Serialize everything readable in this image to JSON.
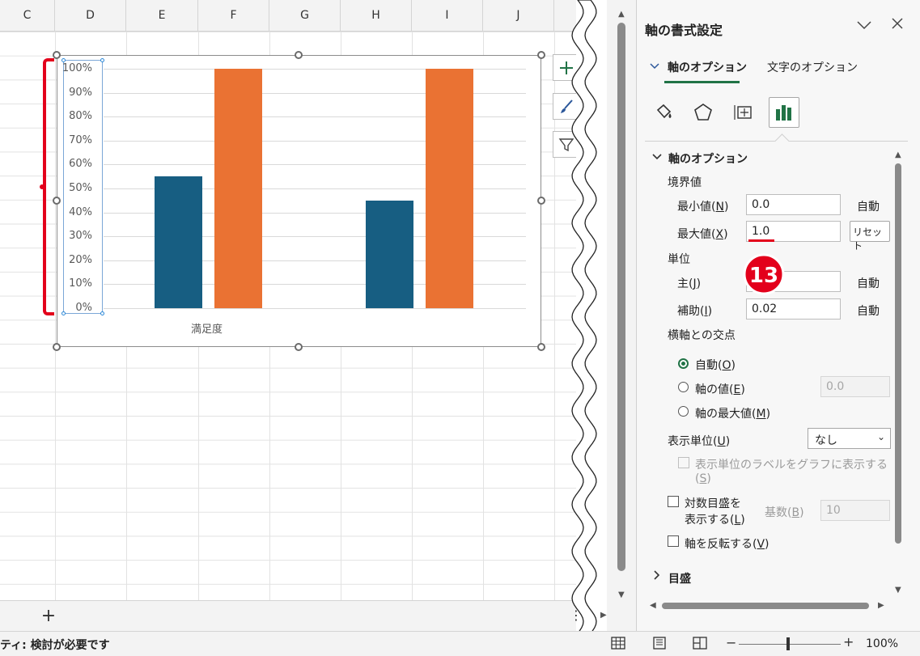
{
  "columns": [
    "C",
    "D",
    "E",
    "F",
    "G",
    "H",
    "I",
    "J"
  ],
  "chart_data": {
    "type": "bar",
    "categories": [
      "満足度"
    ],
    "series": [
      {
        "values": [
          0.55,
          0.45
        ],
        "color": "#175e82"
      },
      {
        "values": [
          1.0,
          1.0
        ],
        "color": "#ea7233"
      }
    ],
    "y_ticks": [
      "100%",
      "90%",
      "80%",
      "70%",
      "60%",
      "50%",
      "40%",
      "30%",
      "20%",
      "10%",
      "0%"
    ],
    "ylim": [
      0,
      1.0
    ],
    "grid": true
  },
  "colors": {
    "bar_blue": "#175e82",
    "bar_orange": "#ea7233",
    "accent_green": "#217346",
    "annotation_red": "#e3001b"
  },
  "sheet": {
    "add_sheet_label": "+",
    "more_label": "⋮",
    "status_text": "ティ: 検討が必要です",
    "zoom_minus": "−",
    "zoom_plus": "+",
    "zoom_level": "100%"
  },
  "pane": {
    "title": "軸の書式設定",
    "tabs": {
      "axis_options": "軸のオプション",
      "text_options": "文字のオプション"
    },
    "icons": [
      "fill-line-icon",
      "effects-icon",
      "size-properties-icon",
      "axis-options-icon"
    ],
    "section_axis_options": "軸のオプション",
    "bounds_label": "境界値",
    "min": {
      "label": "最小値(",
      "key": "N",
      "value": "0.0",
      "status": "自動"
    },
    "max": {
      "label": "最大値(",
      "key": "X",
      "value": "1.0",
      "reset": "リセット"
    },
    "units_label": "単位",
    "major": {
      "label": "主(",
      "key": "J",
      "value": "",
      "status": "自動"
    },
    "minor": {
      "label": "補助(",
      "key": "I",
      "value": "0.02",
      "status": "自動"
    },
    "cross_label": "横軸との交点",
    "cross_auto": {
      "label": "自動(",
      "key": "O"
    },
    "cross_value": {
      "label": "軸の値(",
      "key": "E",
      "value": "0.0"
    },
    "cross_max": {
      "label": "軸の最大値(",
      "key": "M"
    },
    "display_units": {
      "label": "表示単位(",
      "key": "U",
      "value": "なし"
    },
    "show_units_label": {
      "line1": "表示単位のラベルをグラフに表示する",
      "line2_key": "S"
    },
    "log_scale": {
      "line1": "対数目盛を",
      "line2": "表示する(",
      "key": "L",
      "base_label": "基数(",
      "base_key": "B",
      "base_value": "10"
    },
    "reverse": {
      "label": "軸を反転する(",
      "key": "V"
    },
    "tick_marks": "目盛",
    "step_number": "13"
  }
}
